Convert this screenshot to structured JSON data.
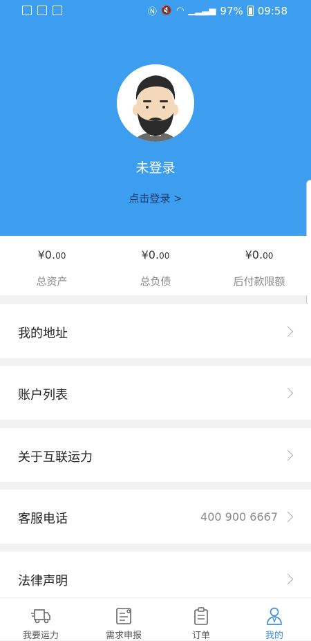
{
  "status_bar": {
    "battery": "97%",
    "time": "09:58"
  },
  "profile": {
    "name": "未登录",
    "login_link": "点击登录 >"
  },
  "summary": [
    {
      "amount_int": "¥0.",
      "amount_dec": "00",
      "label": "总资产"
    },
    {
      "amount_int": "¥0.",
      "amount_dec": "00",
      "label": "总负债"
    },
    {
      "amount_int": "¥0.",
      "amount_dec": "00",
      "label": "后付款限额"
    }
  ],
  "menu": [
    {
      "label": "我的地址",
      "value": ""
    },
    {
      "label": "账户列表",
      "value": ""
    },
    {
      "label": "关于互联运力",
      "value": ""
    },
    {
      "label": "客服电话",
      "value": "400 900 6667"
    },
    {
      "label": "法律声明",
      "value": ""
    }
  ],
  "tabs": [
    {
      "label": "我要运力",
      "icon": "truck-icon",
      "active": false
    },
    {
      "label": "需求申报",
      "icon": "form-icon",
      "active": false
    },
    {
      "label": "订单",
      "icon": "clipboard-icon",
      "active": false
    },
    {
      "label": "我的",
      "icon": "user-icon",
      "active": true
    }
  ],
  "colors": {
    "header_bg": "#3d9ef0",
    "active_tab": "#3d8fd6"
  }
}
